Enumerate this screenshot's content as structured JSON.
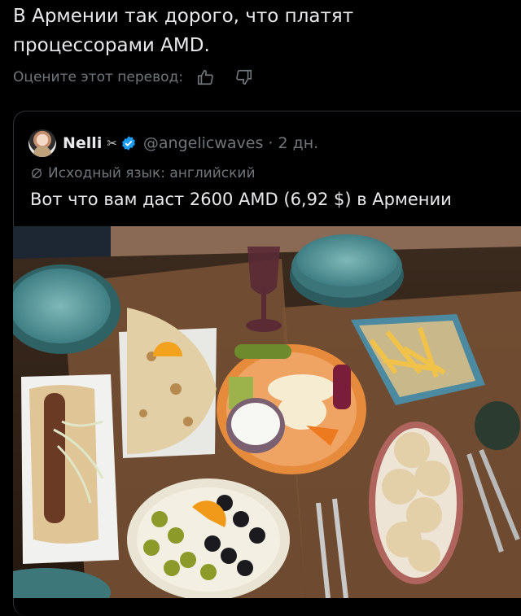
{
  "post": {
    "text_line1": "В Армении так дорого, что платят",
    "text_line2": "процессорами AMD.",
    "rate_translation_label": "Оцените этот перевод:",
    "thumbs_up_icon": "thumbs-up-icon",
    "thumbs_down_icon": "thumbs-down-icon"
  },
  "quote": {
    "author_name": "Nelli",
    "author_emoji": "✂",
    "handle_and_time": "@angelicwaves · 2 дн.",
    "source_language": "Исходный язык: английский",
    "text": "Вот что вам даст 2600 AMD (6,92 $) в Армении",
    "photo_icon": "food-photo"
  },
  "colors": {
    "background": "#000000",
    "text": "#e7e9ea",
    "muted": "#71767b",
    "verified": "#1d9bf0",
    "border": "#2f3336"
  }
}
